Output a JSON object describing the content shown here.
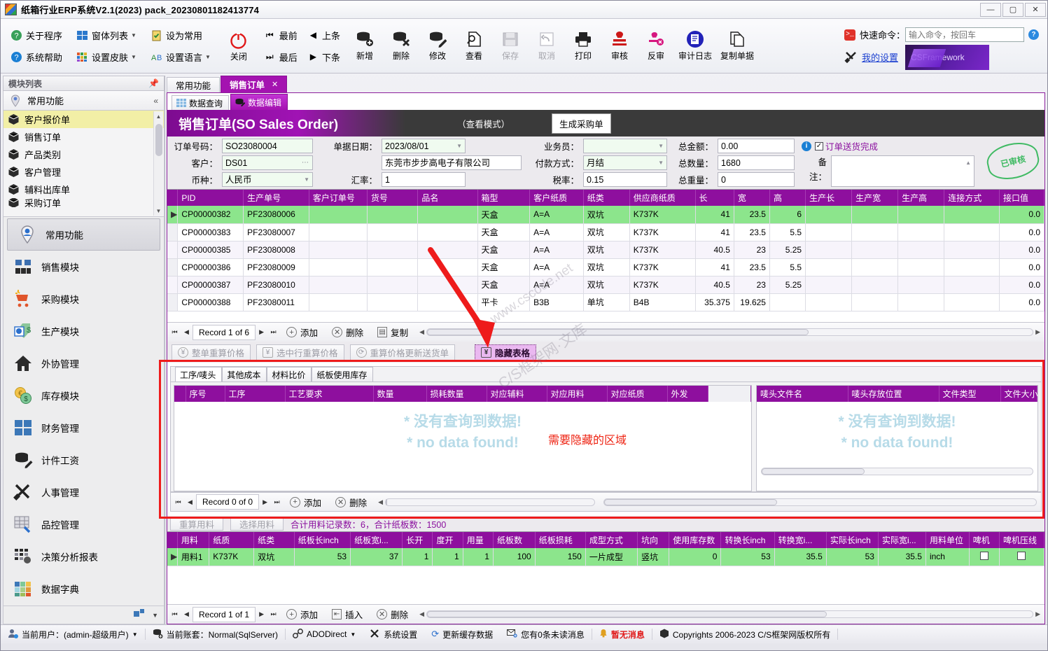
{
  "window": {
    "title": "纸箱行业ERP系统V2.1(2023) pack_20230801182413774",
    "logo_text": "C/S",
    "minimize": "—",
    "maximize": "▢",
    "close": "✕"
  },
  "ribbon": {
    "col1": [
      {
        "label": "关于程序",
        "icon": "about-icon",
        "caret": false
      },
      {
        "label": "系统帮助",
        "icon": "help-icon",
        "caret": false
      }
    ],
    "col2": [
      {
        "label": "窗体列表",
        "icon": "window-list-icon",
        "caret": true
      },
      {
        "label": "设置皮肤",
        "icon": "skin-icon",
        "caret": true
      }
    ],
    "col3": [
      {
        "label": "设为常用",
        "icon": "favorite-icon",
        "caret": false
      },
      {
        "label": "设置语言",
        "icon": "language-icon",
        "caret": true
      }
    ],
    "power": {
      "label": "关闭",
      "icon": "power-icon"
    },
    "nav": [
      {
        "label": "最前",
        "glyph": "⏮"
      },
      {
        "label": "上条",
        "glyph": "◀"
      },
      {
        "label": "最后",
        "glyph": "⏭"
      },
      {
        "label": "下条",
        "glyph": "▶"
      }
    ],
    "big_buttons": [
      {
        "label": "新增",
        "icon": "db-add-icon",
        "disabled": false
      },
      {
        "label": "删除",
        "icon": "db-delete-icon",
        "disabled": false
      },
      {
        "label": "修改",
        "icon": "db-edit-icon",
        "disabled": false
      },
      {
        "label": "查看",
        "icon": "view-icon",
        "disabled": false
      },
      {
        "label": "保存",
        "icon": "save-icon",
        "disabled": true
      },
      {
        "label": "取消",
        "icon": "undo-icon",
        "disabled": true
      },
      {
        "label": "打印",
        "icon": "print-icon",
        "disabled": false
      },
      {
        "label": "审核",
        "icon": "approve-stamp-icon",
        "disabled": false
      },
      {
        "label": "反审",
        "icon": "unapprove-icon",
        "disabled": false
      },
      {
        "label": "审计日志",
        "icon": "audit-log-icon",
        "disabled": false
      },
      {
        "label": "复制单据",
        "icon": "copy-doc-icon",
        "disabled": false
      }
    ],
    "quick_command": {
      "label": "快速命令：",
      "placeholder": "输入命令，按回车",
      "value": "",
      "help": "?"
    },
    "my_settings": "我的设置",
    "brand": "CSFramework"
  },
  "sidebar": {
    "header": "模块列表",
    "pin_icon": "pin-icon",
    "group": {
      "label": "常用功能",
      "collapse": "«"
    },
    "items": [
      {
        "label": "客户报价单",
        "selected": true
      },
      {
        "label": "销售订单",
        "selected": false
      },
      {
        "label": "产品类别",
        "selected": false
      },
      {
        "label": "客户管理",
        "selected": false
      },
      {
        "label": "辅料出库单",
        "selected": false
      },
      {
        "label": "采购订单",
        "selected": false
      }
    ],
    "nav": [
      {
        "label": "常用功能",
        "icon": "user-pin-icon",
        "active": true
      },
      {
        "label": "销售模块",
        "icon": "sales-icon",
        "active": false
      },
      {
        "label": "采购模块",
        "icon": "purchase-cart-icon",
        "active": false
      },
      {
        "label": "生产模块",
        "icon": "production-icon",
        "active": false
      },
      {
        "label": "外协管理",
        "icon": "outsource-home-icon",
        "active": false
      },
      {
        "label": "库存模块",
        "icon": "inventory-coin-icon",
        "active": false
      },
      {
        "label": "财务管理",
        "icon": "finance-window-icon",
        "active": false
      },
      {
        "label": "计件工资",
        "icon": "piecework-icon",
        "active": false
      },
      {
        "label": "人事管理",
        "icon": "hr-tools-icon",
        "active": false
      },
      {
        "label": "品控管理",
        "icon": "qc-grid-icon",
        "active": false
      },
      {
        "label": "决策分析报表",
        "icon": "report-icon",
        "active": false
      },
      {
        "label": "数据字典",
        "icon": "data-dict-icon",
        "active": false
      }
    ]
  },
  "tabs": [
    {
      "label": "常用功能",
      "active": false,
      "closable": false
    },
    {
      "label": "销售订单",
      "active": true,
      "closable": true,
      "close": "✕"
    }
  ],
  "subtabs": [
    {
      "label": "数据查询",
      "active": false,
      "icon": "grid-icon"
    },
    {
      "label": "数据编辑",
      "active": true,
      "icon": "edit-icon"
    }
  ],
  "banner": {
    "title": "销售订单(SO Sales Order)",
    "mode": "（查看模式）",
    "generate_button": "生成采购单"
  },
  "form": {
    "order_no": {
      "label": "订单号码：",
      "value": "SO23080004"
    },
    "customer": {
      "label": "客户：",
      "value": "DS01",
      "ellipsis": "⋯"
    },
    "currency": {
      "label": "币种：",
      "value": "人民币"
    },
    "doc_date": {
      "label": "单据日期：",
      "value": "2023/08/01"
    },
    "customer_name": {
      "label": "",
      "value": "东莞市步步高电子有限公司"
    },
    "exchange_rate": {
      "label": "汇率：",
      "value": "1"
    },
    "salesman": {
      "label": "业务员：",
      "value": ""
    },
    "payment": {
      "label": "付款方式：",
      "value": "月结"
    },
    "tax_rate": {
      "label": "税率：",
      "value": "0.15"
    },
    "total_amount": {
      "label": "总金额：",
      "value": "0.00"
    },
    "total_qty": {
      "label": "总数量：",
      "value": "1680"
    },
    "total_weight": {
      "label": "总重量：",
      "value": "0"
    },
    "delivery_done": {
      "label": "订单送货完成",
      "checked": true,
      "check": "✓"
    },
    "remark": {
      "label": "备注：",
      "value": ""
    },
    "stamp": "已审核"
  },
  "main_grid": {
    "columns": [
      "PID",
      "生产单号",
      "客户订单号",
      "货号",
      "品名",
      "箱型",
      "客户纸质",
      "纸类",
      "供应商纸质",
      "长",
      "宽",
      "高",
      "生产长",
      "生产宽",
      "生产高",
      "连接方式",
      "接口值"
    ],
    "rows": [
      {
        "selected": true,
        "indicator": "▶",
        "cells": [
          "CP00000382",
          "PF23080006",
          "",
          "",
          "",
          "天盒",
          "A=A",
          "双坑",
          "K737K",
          "41",
          "23.5",
          "6",
          "",
          "",
          "",
          "",
          "0.0"
        ]
      },
      {
        "selected": false,
        "indicator": "",
        "cells": [
          "CP00000383",
          "PF23080007",
          "",
          "",
          "",
          "天盒",
          "A=A",
          "双坑",
          "K737K",
          "41",
          "23.5",
          "5.5",
          "",
          "",
          "",
          "",
          "0.0"
        ]
      },
      {
        "selected": false,
        "indicator": "",
        "cells": [
          "CP00000385",
          "PF23080008",
          "",
          "",
          "",
          "天盒",
          "A=A",
          "双坑",
          "K737K",
          "40.5",
          "23",
          "5.25",
          "",
          "",
          "",
          "",
          "0.0"
        ]
      },
      {
        "selected": false,
        "indicator": "",
        "cells": [
          "CP00000386",
          "PF23080009",
          "",
          "",
          "",
          "天盒",
          "A=A",
          "双坑",
          "K737K",
          "41",
          "23.5",
          "5.5",
          "",
          "",
          "",
          "",
          "0.0"
        ]
      },
      {
        "selected": false,
        "indicator": "",
        "cells": [
          "CP00000387",
          "PF23080010",
          "",
          "",
          "",
          "天盒",
          "A=A",
          "双坑",
          "K737K",
          "40.5",
          "23",
          "5.25",
          "",
          "",
          "",
          "",
          "0.0"
        ]
      },
      {
        "selected": false,
        "indicator": "",
        "cells": [
          "CP00000388",
          "PF23080011",
          "",
          "",
          "",
          "平卡",
          "B3B",
          "单坑",
          "B4B",
          "35.375",
          "19.625",
          "",
          "",
          "",
          "",
          "",
          "0.0"
        ]
      }
    ],
    "nav": {
      "first": "⏮",
      "prev": "◀",
      "next": "▶",
      "last": "⏭",
      "record": "Record 1 of 6",
      "add": "添加",
      "delete": "删除",
      "copy": "复制"
    }
  },
  "action_buttons": [
    {
      "label": "整单重算价格",
      "highlighted": false
    },
    {
      "label": "选中行重算价格",
      "highlighted": false
    },
    {
      "label": "重算价格更新送货单",
      "highlighted": false
    },
    {
      "label": "隐藏表格",
      "highlighted": true
    }
  ],
  "mid_section": {
    "tabs": [
      {
        "label": "工序/唛头",
        "active": true
      },
      {
        "label": "其他成本",
        "active": false
      },
      {
        "label": "材料比价",
        "active": false
      },
      {
        "label": "纸板使用库存",
        "active": false
      }
    ],
    "left_columns": [
      "序号",
      "工序",
      "工艺要求",
      "数量",
      "损耗数量",
      "对应辅料",
      "对应用料",
      "对应纸质",
      "外发",
      ""
    ],
    "right_columns": [
      "唛头文件名",
      "唛头存放位置",
      "文件类型",
      "文件大小"
    ],
    "no_data_cn": "* 没有查询到数据!",
    "no_data_en": "* no data found!",
    "annotation": "需要隐藏的区域",
    "nav": {
      "first": "⏮",
      "prev": "◀",
      "next": "▶",
      "last": "⏭",
      "record": "Record 0 of 0",
      "add": "添加",
      "delete": "删除"
    }
  },
  "bottom_section": {
    "recalc_button": "重算用料",
    "select_button": "选择用料",
    "summary": "合计用料记录数：6，合计纸板数：1500",
    "columns": [
      "用料",
      "纸质",
      "纸类",
      "纸板长inch",
      "纸板宽i...",
      "长开",
      "度开",
      "用量",
      "纸板数",
      "纸板损耗",
      "成型方式",
      "坑向",
      "使用库存数",
      "转换长inch",
      "转换宽i...",
      "实际长inch",
      "实际宽i...",
      "用料单位",
      "啤机",
      "啤机压线"
    ],
    "rows": [
      {
        "selected": true,
        "indicator": "▶",
        "cells": [
          "用料1",
          "K737K",
          "双坑",
          "53",
          "37",
          "1",
          "1",
          "1",
          "100",
          "150",
          "一片成型",
          "竖坑",
          "0",
          "53",
          "35.5",
          "53",
          "35.5",
          "inch",
          "",
          ""
        ]
      }
    ],
    "nav": {
      "first": "⏮",
      "prev": "◀",
      "next": "▶",
      "last": "⏭",
      "record": "Record 1 of 1",
      "add": "添加",
      "insert": "插入",
      "delete": "删除"
    }
  },
  "statusbar": {
    "current_user": "当前用户：(admin-超级用户)",
    "current_db": "当前账套：Normal(SqlServer)",
    "ado": "ADODirect",
    "system_settings": "系统设置",
    "refresh_cache": "更新缓存数据",
    "messages": "您有0条未读消息",
    "no_messages": "暂无消息",
    "copyright": "Copyrights 2006-2023 C/S框架网版权所有"
  },
  "watermarks": [
    "www.cscode.net",
    "C/S框架网·文库"
  ],
  "colors": {
    "accent_purple": "#8e0f9e",
    "tab_purple": "#a413b0",
    "selected_row_green": "#8ce58c",
    "annotation_red": "#ee1b1b",
    "no_data_blue": "#b7dbe8"
  }
}
